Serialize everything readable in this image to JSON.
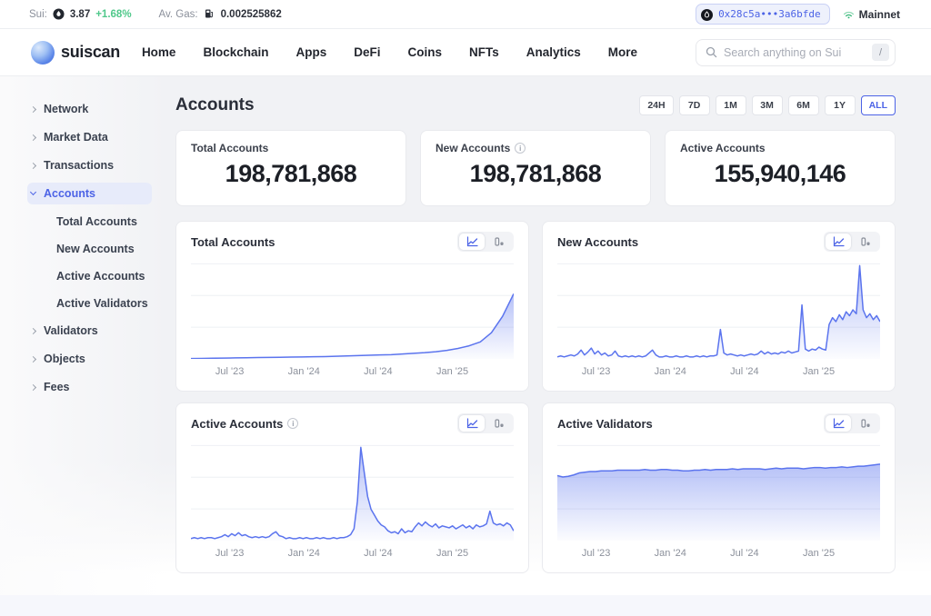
{
  "topbar": {
    "sui_label": "Sui:",
    "sui_price": "3.87",
    "sui_change": "+1.68%",
    "gas_label": "Av. Gas:",
    "gas_value": "0.002525862",
    "wallet_address": "0x28c5a•••3a6bfde",
    "network": "Mainnet"
  },
  "nav": {
    "brand": "suiscan",
    "items": [
      "Home",
      "Blockchain",
      "Apps",
      "DeFi",
      "Coins",
      "NFTs",
      "Analytics",
      "More"
    ],
    "search_placeholder": "Search anything on Sui",
    "search_shortcut": "/"
  },
  "sidebar": {
    "items": [
      {
        "label": "Network"
      },
      {
        "label": "Market Data"
      },
      {
        "label": "Transactions"
      },
      {
        "label": "Accounts",
        "active": true,
        "expanded": true,
        "children": [
          "Total Accounts",
          "New Accounts",
          "Active Accounts",
          "Active Validators"
        ]
      },
      {
        "label": "Validators"
      },
      {
        "label": "Objects"
      },
      {
        "label": "Fees"
      }
    ]
  },
  "page": {
    "title": "Accounts"
  },
  "time_ranges": {
    "options": [
      "24H",
      "7D",
      "1M",
      "3M",
      "6M",
      "1Y",
      "ALL"
    ],
    "selected": "ALL"
  },
  "stats": [
    {
      "label": "Total Accounts",
      "value": "198,781,868"
    },
    {
      "label": "New Accounts",
      "value": "198,781,868",
      "info": true
    },
    {
      "label": "Active Accounts",
      "value": "155,940,146"
    }
  ],
  "colors": {
    "accent_blue": "#4c63e6",
    "chart_line": "#5b74ee",
    "positive_green": "#4fc88a",
    "mainnet_green": "#2fb574"
  },
  "chart_data": [
    {
      "type": "area",
      "title": "Total Accounts",
      "y_unit": "millions of accounts (estimated)",
      "x_tick_labels": [
        "Jul '23",
        "Jan '24",
        "Jul '24",
        "Jan '25"
      ],
      "x_tick_positions": [
        0.12,
        0.35,
        0.58,
        0.81
      ],
      "ymax": 300,
      "values": [
        1,
        1.5,
        2,
        2.5,
        3,
        3.5,
        4,
        4.5,
        5,
        5.5,
        6,
        6.5,
        7,
        8,
        9,
        10,
        11,
        12,
        13,
        15,
        17,
        19,
        22,
        26,
        32,
        40,
        52,
        80,
        130,
        199
      ]
    },
    {
      "type": "line",
      "title": "New Accounts",
      "y_unit": "relative daily new accounts (estimated, % of axis)",
      "x_tick_labels": [
        "Jul '23",
        "Jan '24",
        "Jul '24",
        "Jan '25"
      ],
      "x_tick_positions": [
        0.12,
        0.35,
        0.58,
        0.81
      ],
      "ymax": 100,
      "values": [
        2,
        3,
        2,
        3,
        4,
        3,
        5,
        9,
        4,
        7,
        11,
        5,
        8,
        4,
        6,
        3,
        4,
        8,
        3,
        2,
        3,
        2,
        3,
        2,
        3,
        2,
        3,
        6,
        9,
        4,
        2,
        2,
        3,
        2,
        2,
        3,
        2,
        2,
        3,
        2,
        2,
        3,
        2,
        3,
        2,
        3,
        3,
        4,
        30,
        6,
        4,
        5,
        4,
        3,
        4,
        3,
        4,
        5,
        4,
        5,
        8,
        5,
        7,
        5,
        6,
        5,
        7,
        6,
        8,
        6,
        7,
        8,
        55,
        10,
        8,
        10,
        9,
        12,
        10,
        9,
        35,
        42,
        38,
        45,
        40,
        48,
        44,
        50,
        46,
        95,
        50,
        42,
        46,
        40,
        44,
        38
      ]
    },
    {
      "type": "line",
      "title": "Active Accounts",
      "info": true,
      "y_unit": "relative daily active accounts (estimated, % of axis)",
      "x_tick_labels": [
        "Jul '23",
        "Jan '24",
        "Jul '24",
        "Jan '25"
      ],
      "x_tick_positions": [
        0.12,
        0.35,
        0.58,
        0.81
      ],
      "ymax": 100,
      "values": [
        2,
        3,
        2,
        3,
        2,
        3,
        3,
        2,
        3,
        4,
        6,
        4,
        7,
        5,
        8,
        5,
        6,
        4,
        3,
        4,
        3,
        4,
        3,
        4,
        7,
        9,
        5,
        4,
        2,
        3,
        2,
        2,
        3,
        2,
        3,
        2,
        2,
        3,
        2,
        3,
        2,
        2,
        3,
        2,
        3,
        3,
        4,
        6,
        12,
        40,
        95,
        70,
        45,
        32,
        26,
        20,
        16,
        14,
        10,
        8,
        9,
        7,
        12,
        8,
        10,
        9,
        14,
        18,
        15,
        19,
        16,
        14,
        17,
        13,
        15,
        14,
        13,
        15,
        12,
        14,
        16,
        13,
        15,
        12,
        16,
        14,
        15,
        17,
        30,
        18,
        16,
        17,
        15,
        18,
        16,
        10
      ]
    },
    {
      "type": "area",
      "title": "Active Validators",
      "y_unit": "validators (estimated)",
      "x_tick_labels": [
        "Jul '23",
        "Jan '24",
        "Jul '24",
        "Jan '25"
      ],
      "x_tick_positions": [
        0.12,
        0.35,
        0.58,
        0.81
      ],
      "ymax": 145,
      "values": [
        96,
        94,
        95,
        97,
        100,
        101,
        102,
        102,
        103,
        103,
        103,
        104,
        104,
        104,
        104,
        104,
        105,
        104,
        104,
        105,
        105,
        104,
        104,
        103,
        103,
        104,
        104,
        105,
        104,
        105,
        105,
        105,
        106,
        105,
        106,
        106,
        106,
        106,
        105,
        106,
        107,
        106,
        107,
        107,
        107,
        106,
        107,
        108,
        108,
        107,
        108,
        108,
        109,
        108,
        109,
        110,
        110,
        111,
        112,
        113
      ]
    }
  ]
}
